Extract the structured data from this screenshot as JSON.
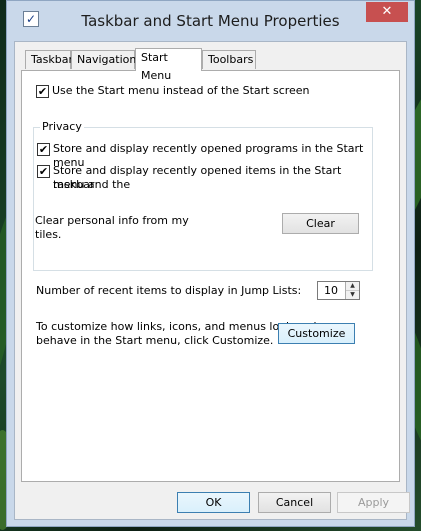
{
  "window": {
    "title": "Taskbar and Start Menu Properties",
    "app_icon_glyph": "✓",
    "close_glyph": "✕"
  },
  "tabs": [
    {
      "label": "Taskbar",
      "active": false
    },
    {
      "label": "Navigation",
      "active": false
    },
    {
      "label": "Start Menu",
      "active": true
    },
    {
      "label": "Toolbars",
      "active": false
    }
  ],
  "start_menu": {
    "use_start_menu": {
      "label": "Use the Start menu instead of the Start screen",
      "checked": true,
      "mark": "✔"
    },
    "privacy": {
      "title": "Privacy",
      "store_programs": {
        "label": "Store and display recently opened programs in the Start menu",
        "checked": true,
        "mark": "✔"
      },
      "store_items": {
        "label_line1": "Store and display recently opened items in the Start menu and the",
        "label_line2": "taskbar",
        "checked": true,
        "mark": "✔"
      },
      "clear_info_line1": "Clear personal info from my",
      "clear_info_line2": "tiles.",
      "clear_button": "Clear"
    },
    "jump_lists": {
      "label": "Number of recent items to display in Jump Lists:",
      "value": "10",
      "up_glyph": "▲",
      "down_glyph": "▼"
    },
    "customize": {
      "text_line1": "To customize how links, icons, and menus look and",
      "text_line2": "behave in the Start menu, click Customize.",
      "button": "Customize"
    }
  },
  "footer": {
    "ok": "OK",
    "cancel": "Cancel",
    "apply": "Apply"
  }
}
